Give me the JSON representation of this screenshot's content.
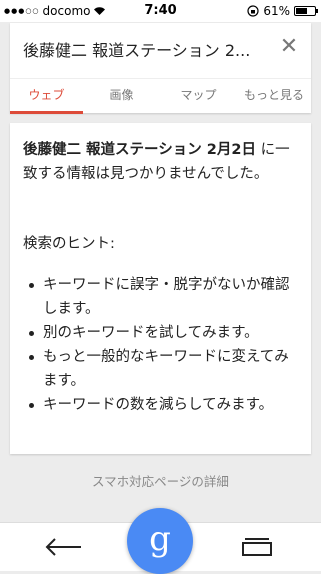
{
  "status_bar": {
    "signal": "●●●○○",
    "carrier": "docomo",
    "time": "7:40",
    "battery": "61%",
    "battery_level": 0.61
  },
  "search": {
    "query": "後藤健二 報道ステーション 2..."
  },
  "tabs": [
    {
      "label": "ウェブ",
      "active": true
    },
    {
      "label": "画像",
      "active": false
    },
    {
      "label": "マップ",
      "active": false
    },
    {
      "label": "もっと見る",
      "active": false
    }
  ],
  "result": {
    "query_bold": "後藤健二 報道ステーション 2月2日",
    "no_match_text": " に一致する情報は見つかりませんでした。",
    "hints_title": "検索のヒント:",
    "hints": [
      "キーワードに誤字・脱字がないか確認します。",
      "別のキーワードを試してみます。",
      "もっと一般的なキーワードに変えてみます。",
      "キーワードの数を減らしてみます。"
    ]
  },
  "mobile_link": "スマホ対応ページの詳細",
  "bottom_bar": {
    "fab_letter": "g"
  },
  "colors": {
    "accent": "#dd4b39",
    "fab": "#4a8af4"
  }
}
